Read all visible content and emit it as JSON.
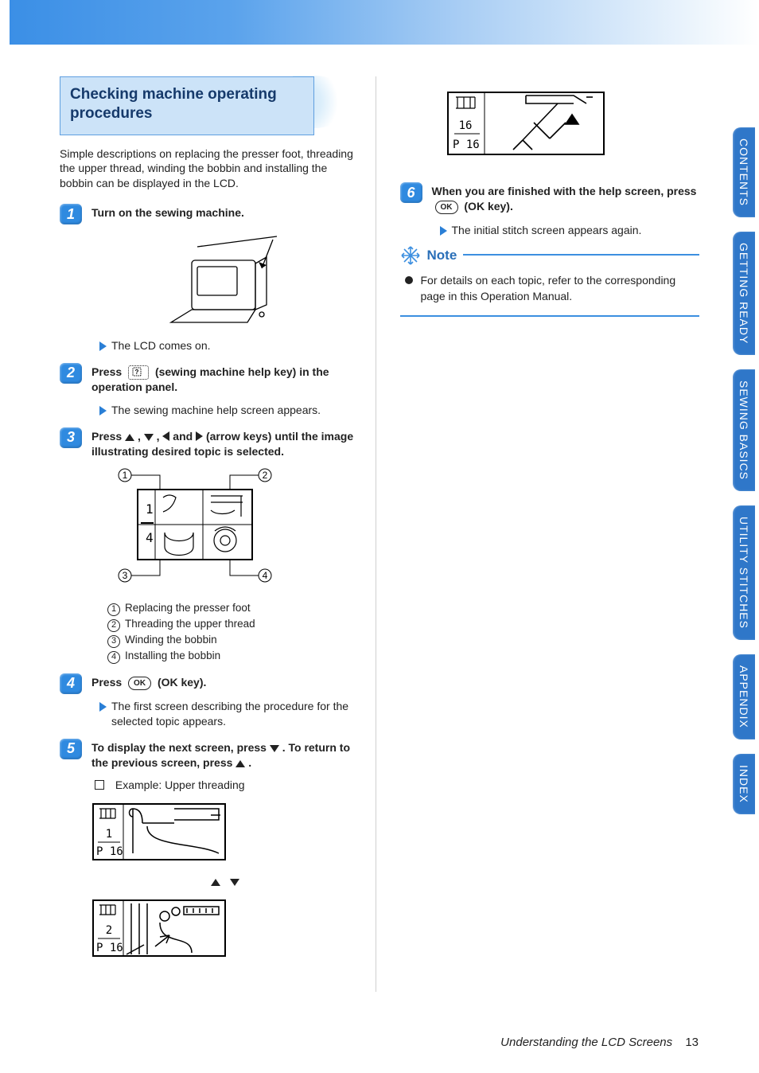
{
  "header": {
    "title": "Checking machine operating procedures"
  },
  "intro": "Simple descriptions on replacing the presser foot, threading the upper thread, winding the bobbin and installing the bobbin can be displayed in the LCD.",
  "steps": {
    "s1": {
      "title": "Turn on the sewing machine.",
      "result": "The LCD comes on."
    },
    "s2": {
      "title_before": "Press",
      "title_after": "(sewing machine help key) in the operation panel.",
      "result": "The sewing machine help screen appears."
    },
    "s3": {
      "title_before": "Press",
      "title_mid": ",",
      "title_mid2": ",",
      "title_mid3": "and",
      "title_after": "(arrow keys) until the image illustrating desired topic is selected.",
      "topics": {
        "t1": "Replacing the presser foot",
        "t2": "Threading the upper thread",
        "t3": "Winding the bobbin",
        "t4": "Installing the bobbin"
      }
    },
    "s4": {
      "title_before": "Press",
      "title_after": "(OK key).",
      "result": "The first screen describing the procedure for the selected topic appears."
    },
    "s5": {
      "title_before": "To display the next screen, press",
      "title_mid": ". To return to the previous screen, press",
      "title_after": ".",
      "example_label": "Example: Upper threading"
    },
    "s6": {
      "title_before": "When you are finished with the help screen, press",
      "title_after": "(OK key).",
      "result": "The initial stitch screen appears again."
    }
  },
  "note": {
    "label": "Note",
    "text": "For details on each topic, refer to the corresponding page in this Operation Manual."
  },
  "tabs": {
    "t1": "CONTENTS",
    "t2": "GETTING READY",
    "t3": "SEWING BASICS",
    "t4": "UTILITY STITCHES",
    "t5": "APPENDIX",
    "t6": "INDEX"
  },
  "footer": {
    "section": "Understanding the LCD Screens",
    "page": "13"
  },
  "lcd": {
    "help_page": "1",
    "help_total": "4",
    "screen1_num": "1",
    "screen1_page": "P 16",
    "screen2_num": "2",
    "screen2_page": "P 16",
    "screen3_num": "16",
    "screen3_page": "P 16"
  }
}
